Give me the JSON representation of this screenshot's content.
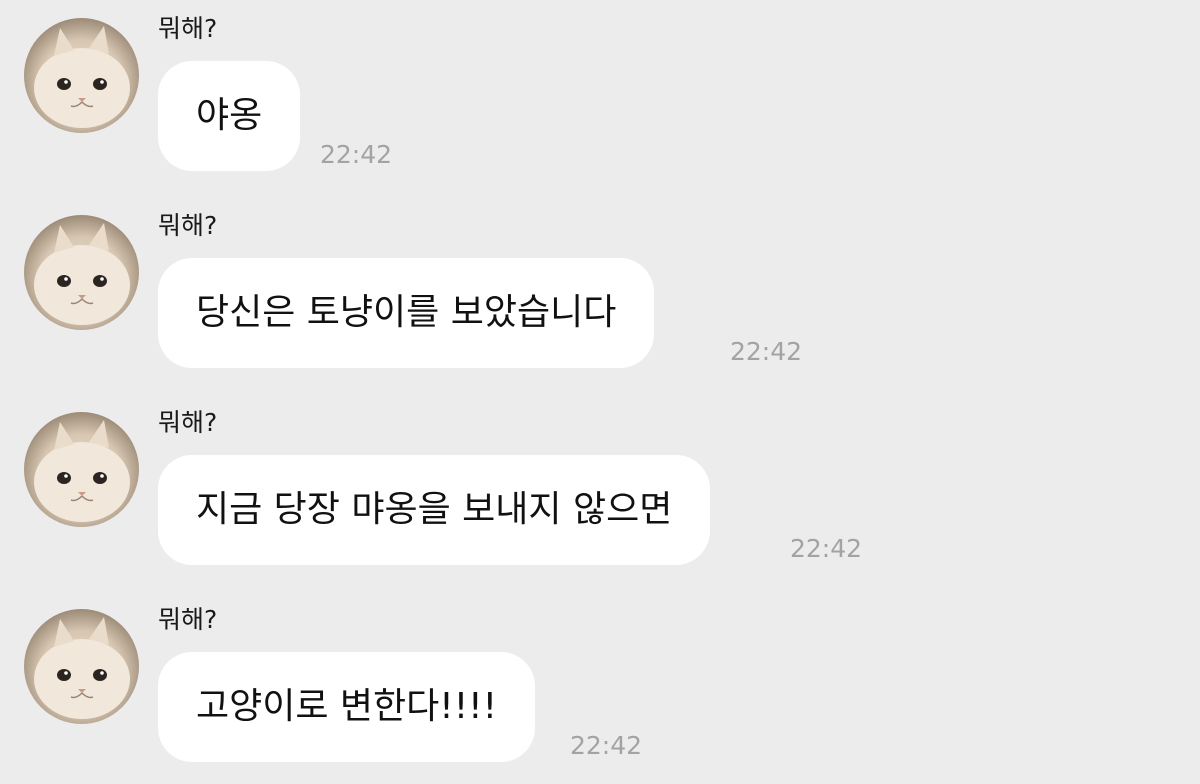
{
  "chat": {
    "messages": [
      {
        "sender": "뭐해?",
        "text": "야옹",
        "time": "22:42"
      },
      {
        "sender": "뭐해?",
        "text": "당신은 토냥이를 보았습니다",
        "time": "22:42"
      },
      {
        "sender": "뭐해?",
        "text": "지금 당장 먀옹을 보내지 않으면",
        "time": "22:42"
      },
      {
        "sender": "뭐해?",
        "text": "고양이로 변한다!!!!",
        "time": "22:42"
      }
    ]
  },
  "colors": {
    "background": "#ececec",
    "bubble": "#ffffff",
    "timestamp": "#a3a3a3"
  },
  "icons": {
    "avatar": "cat-avatar-icon"
  }
}
